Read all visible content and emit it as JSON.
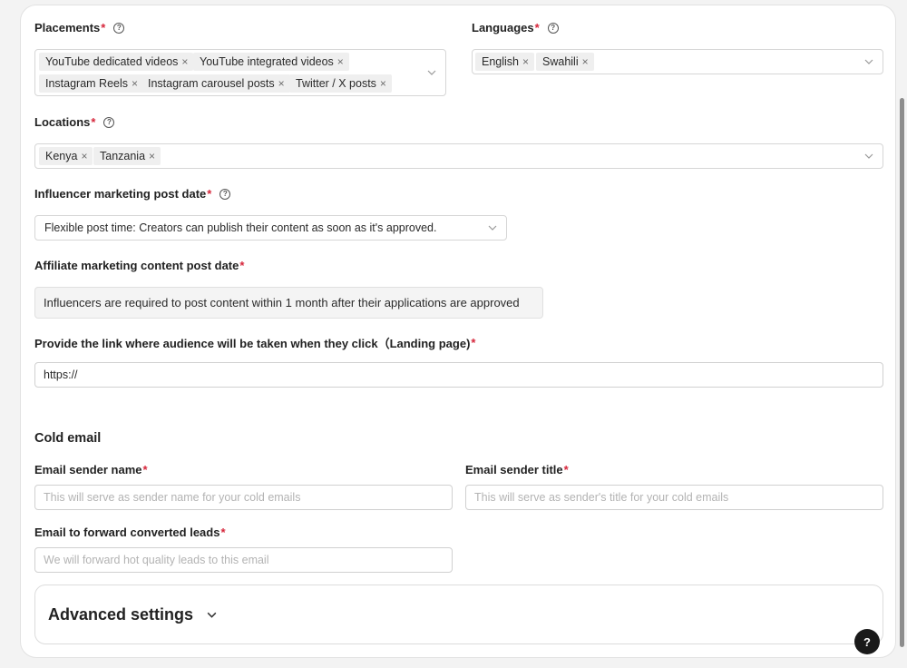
{
  "placements": {
    "label": "Placements",
    "required": "*",
    "help_icon": "question-circle-icon",
    "tags": [
      "YouTube dedicated videos",
      "YouTube integrated videos",
      "Instagram Reels",
      "Instagram carousel posts",
      "Twitter / X posts"
    ]
  },
  "languages": {
    "label": "Languages",
    "required": "*",
    "help_icon": "question-circle-icon",
    "tags": [
      "English",
      "Swahili"
    ]
  },
  "locations": {
    "label": "Locations",
    "required": "*",
    "help_icon": "question-circle-icon",
    "tags": [
      "Kenya",
      "Tanzania"
    ]
  },
  "influencer_post_date": {
    "label": "Influencer marketing post date",
    "required": "*",
    "help_icon": "question-circle-icon",
    "selected": "Flexible post time: Creators can publish their content as soon as it's approved."
  },
  "affiliate_post_date": {
    "label": "Affiliate marketing content post date",
    "required": "*",
    "value": "Influencers are required to post content within 1 month after their applications are approved"
  },
  "landing_page": {
    "label": "Provide the link where audience will be taken when they click（Landing page)",
    "required": "*",
    "value": "https://"
  },
  "cold_email": {
    "title": "Cold email",
    "sender_name": {
      "label": "Email sender name",
      "required": "*",
      "placeholder": "This will serve as sender name for your cold emails"
    },
    "sender_title": {
      "label": "Email sender title",
      "required": "*",
      "placeholder": "This will serve as sender's title for your cold emails"
    },
    "forward_email": {
      "label": "Email to forward converted leads",
      "required": "*",
      "placeholder": "We will forward hot quality leads to this email"
    }
  },
  "advanced_settings": {
    "label": "Advanced settings",
    "icon": "chevron-down-icon"
  },
  "help_button": {
    "label": "?"
  },
  "tag_remove_glyph": "×",
  "help_glyph": "?",
  "colors": {
    "required": "#d6263b",
    "tag_bg": "#efefef",
    "readonly_bg": "#f4f4f4",
    "fab_bg": "#1a1a1a"
  }
}
